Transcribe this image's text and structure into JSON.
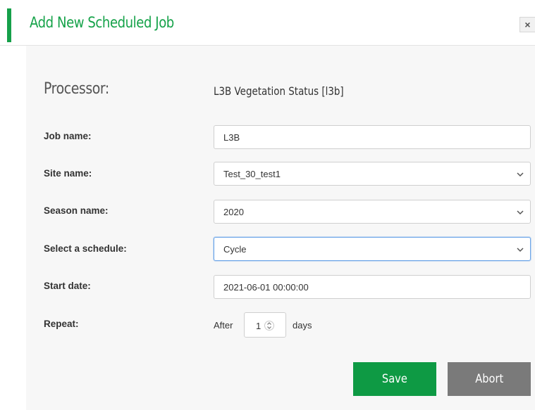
{
  "dialog": {
    "title": "Add New Scheduled Job",
    "close_label": "×"
  },
  "processor": {
    "label": "Processor:",
    "value": "L3B Vegetation Status [l3b]"
  },
  "fields": {
    "job_name": {
      "label": "Job name:",
      "value": "L3B"
    },
    "site_name": {
      "label": "Site name:",
      "value": "Test_30_test1"
    },
    "season_name": {
      "label": "Season name:",
      "value": "2020"
    },
    "schedule": {
      "label": "Select a schedule:",
      "value": "Cycle"
    },
    "start_date": {
      "label": "Start date:",
      "value": "2021-06-01 00:00:00"
    },
    "repeat": {
      "label": "Repeat:",
      "prefix": "After",
      "value": "1",
      "suffix": "days"
    }
  },
  "buttons": {
    "save": "Save",
    "abort": "Abort"
  },
  "colors": {
    "accent": "#16a04a",
    "save_button": "#0e9a44",
    "abort_button": "#7a7a7a",
    "focus_border": "#6ea6e8"
  },
  "icons": {
    "close": "close-icon",
    "dropdown": "chevron-down-icon",
    "spinner": "spinner-arrows-icon"
  }
}
